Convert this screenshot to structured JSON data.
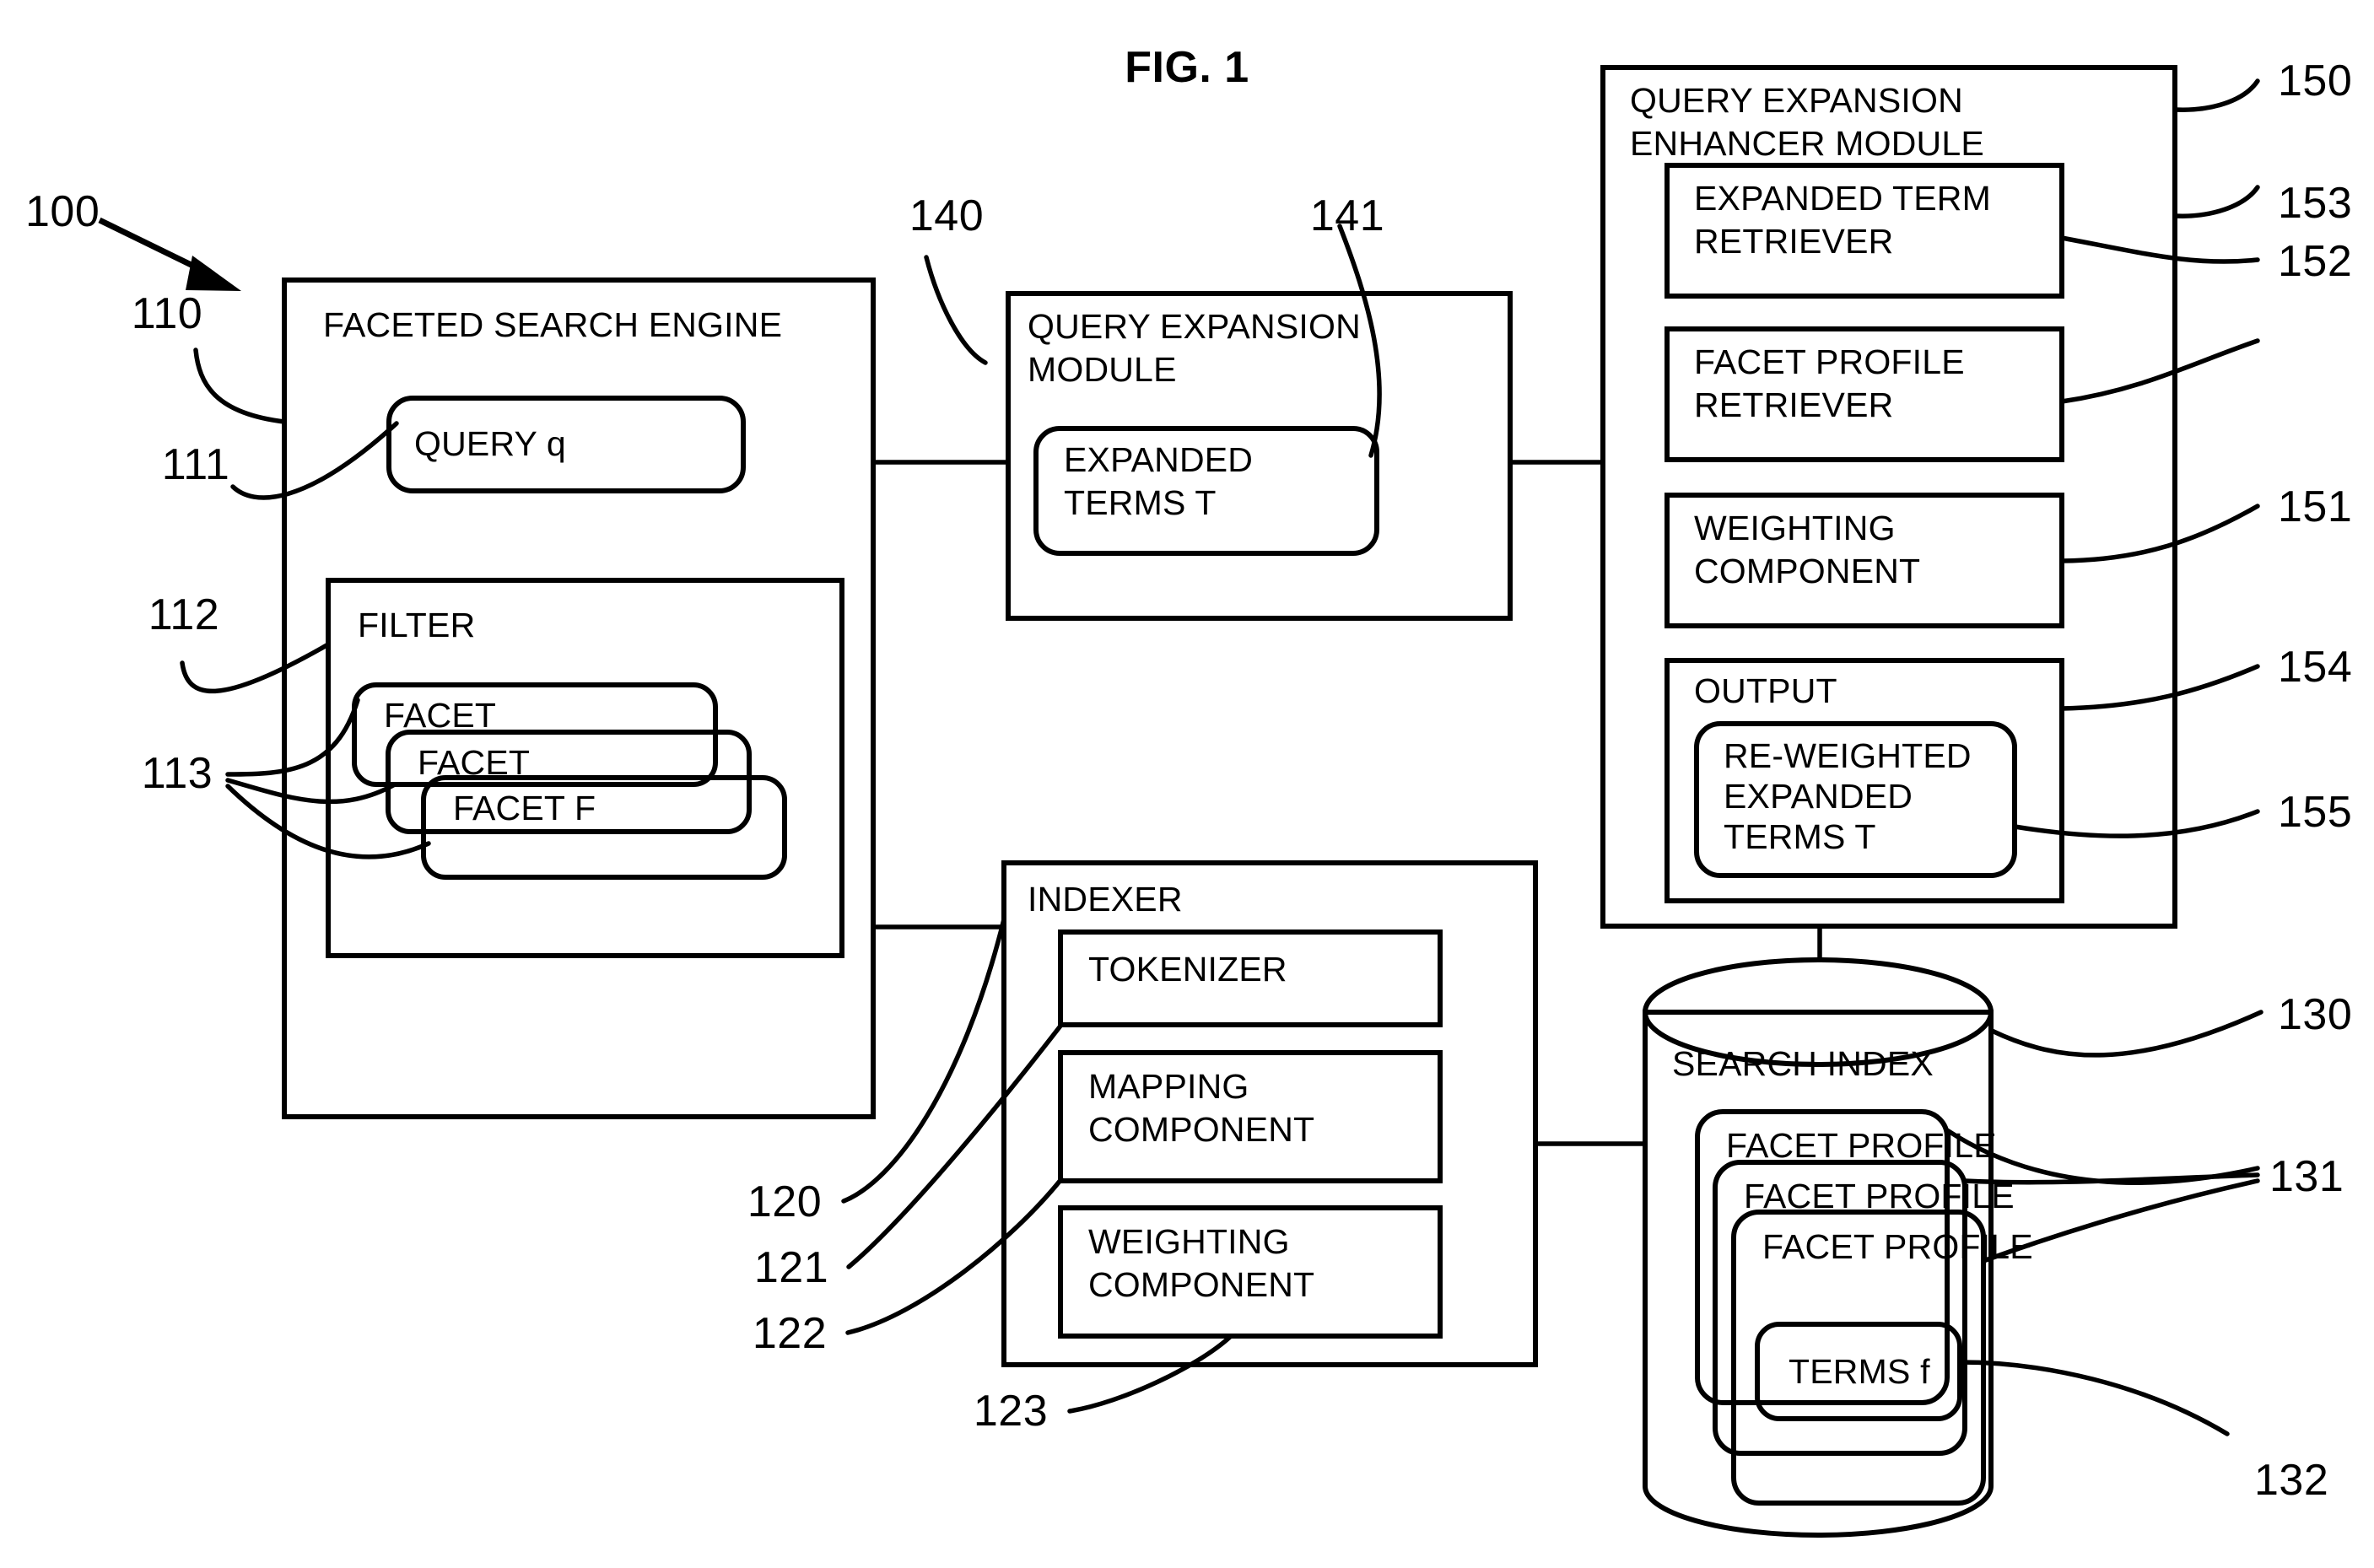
{
  "figure": {
    "title": "FIG. 1",
    "system_ref": "100"
  },
  "blocks": {
    "faceted_search_engine": {
      "label": "FACETED SEARCH ENGINE",
      "ref": "110",
      "query": {
        "label": "QUERY q",
        "ref": "111"
      },
      "filter": {
        "label": "FILTER",
        "ref": "112",
        "facets_ref": "113",
        "facets": [
          {
            "label": "FACET"
          },
          {
            "label": "FACET"
          },
          {
            "label": "FACET F"
          }
        ]
      }
    },
    "query_expansion_module": {
      "label_line1": "QUERY EXPANSION",
      "label_line2": "MODULE",
      "ref": "140",
      "expanded_terms": {
        "line1": "EXPANDED",
        "line2": "TERMS T",
        "ref": "141"
      }
    },
    "query_expansion_enhancer_module": {
      "label_line1": "QUERY EXPANSION",
      "label_line2": "ENHANCER MODULE",
      "ref": "150",
      "children": [
        {
          "line1": "EXPANDED TERM",
          "line2": "RETRIEVER",
          "ref": "152"
        },
        {
          "line1": "FACET PROFILE",
          "line2": "RETRIEVER",
          "ref": "153"
        },
        {
          "line1": "WEIGHTING",
          "line2": "COMPONENT",
          "ref": "151"
        }
      ],
      "output": {
        "label": "OUTPUT",
        "ref": "154",
        "reweighted": {
          "line1": "RE-WEIGHTED",
          "line2": "EXPANDED",
          "line3": "TERMS T",
          "ref": "155"
        }
      }
    },
    "indexer": {
      "label": "INDEXER",
      "ref": "120",
      "children": [
        {
          "line1": "TOKENIZER",
          "line2": "",
          "ref": "121"
        },
        {
          "line1": "MAPPING",
          "line2": "COMPONENT",
          "ref": "122"
        },
        {
          "line1": "WEIGHTING",
          "line2": "COMPONENT",
          "ref": "123"
        }
      ]
    },
    "search_index": {
      "label": "SEARCH INDEX",
      "ref": "130",
      "facet_profiles_ref": "131",
      "facet_profiles": [
        {
          "label": "FACET PROFILE"
        },
        {
          "label": "FACET PROFILE"
        },
        {
          "label": "FACET PROFILE"
        }
      ],
      "terms": {
        "label": "TERMS f",
        "ref": "132"
      }
    }
  }
}
